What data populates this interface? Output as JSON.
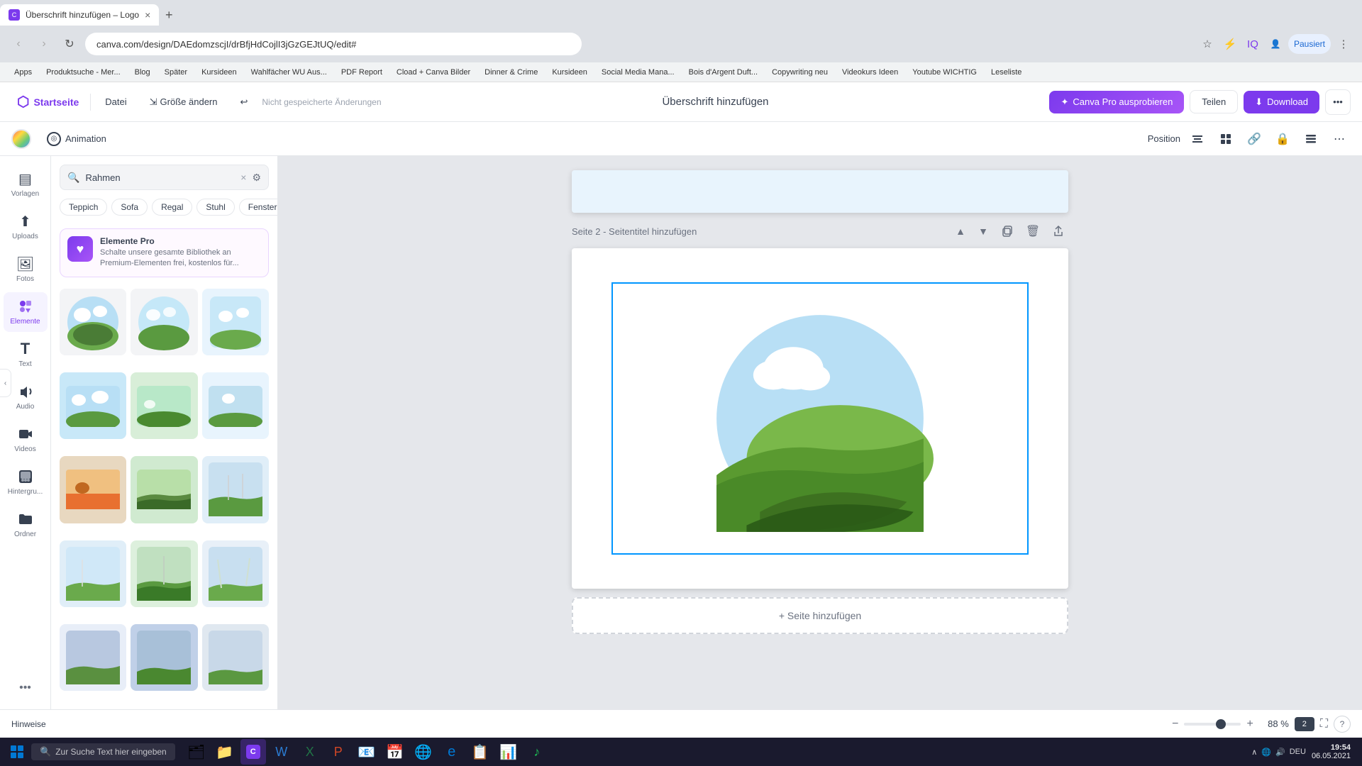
{
  "browser": {
    "tab_title": "Überschrift hinzufügen – Logo",
    "address": "canva.com/design/DAEdomzscjI/drBfjHdCojlI3jGzGEJtUQ/edit#",
    "bookmarks": [
      {
        "label": "Apps"
      },
      {
        "label": "Produktsuche - Mer..."
      },
      {
        "label": "Blog"
      },
      {
        "label": "Später"
      },
      {
        "label": "Kursideen"
      },
      {
        "label": "Wahlfächer WU Aus..."
      },
      {
        "label": "PDF Report"
      },
      {
        "label": "Cload + Canva Bilder"
      },
      {
        "label": "Dinner & Crime"
      },
      {
        "label": "Kursideen"
      },
      {
        "label": "Social Media Mana..."
      },
      {
        "label": "Bois d'Argent Duft..."
      },
      {
        "label": "Copywriting neu"
      },
      {
        "label": "Videokurs Ideen"
      },
      {
        "label": "Youtube WICHTIG"
      },
      {
        "label": "Leseliste"
      }
    ]
  },
  "toolbar": {
    "home_label": "Startseite",
    "file_label": "Datei",
    "resize_label": "Größe ändern",
    "unsaved_label": "Nicht gespeicherte Änderungen",
    "page_title": "Überschrift hinzufügen",
    "pro_label": "Canva Pro ausprobieren",
    "share_label": "Teilen",
    "download_label": "Download"
  },
  "canvas_toolbar": {
    "animation_label": "Animation",
    "position_label": "Position"
  },
  "sidebar": {
    "items": [
      {
        "label": "Vorlagen",
        "icon": "▤"
      },
      {
        "label": "Uploads",
        "icon": "↑"
      },
      {
        "label": "Fotos",
        "icon": "🖼"
      },
      {
        "label": "Elemente",
        "icon": "✦"
      },
      {
        "label": "Text",
        "icon": "T"
      },
      {
        "label": "Audio",
        "icon": "♪"
      },
      {
        "label": "Videos",
        "icon": "▶"
      },
      {
        "label": "Hintergru...",
        "icon": "⬛"
      },
      {
        "label": "Ordner",
        "icon": "📁"
      }
    ]
  },
  "search_panel": {
    "search_placeholder": "Rahmen",
    "filter_tags": [
      "Teppich",
      "Sofa",
      "Regal",
      "Stuhl",
      "Fenster"
    ],
    "pro_banner": {
      "title": "Elemente Pro",
      "description": "Schalte unsere gesamte Bibliothek an Premium-Elementen frei, kostenlos für..."
    }
  },
  "pages": [
    {
      "title": "Seite 2 - Seitentitel hinzufügen"
    }
  ],
  "add_page_label": "+ Seite hinzufügen",
  "hints_bar": {
    "label": "Hinweise",
    "zoom_percent": "88 %",
    "page_num": "2"
  },
  "taskbar": {
    "search_placeholder": "Zur Suche Text hier eingeben",
    "time": "19:54",
    "date": "06.05.2021",
    "systray": [
      "∧",
      "DEU"
    ]
  }
}
